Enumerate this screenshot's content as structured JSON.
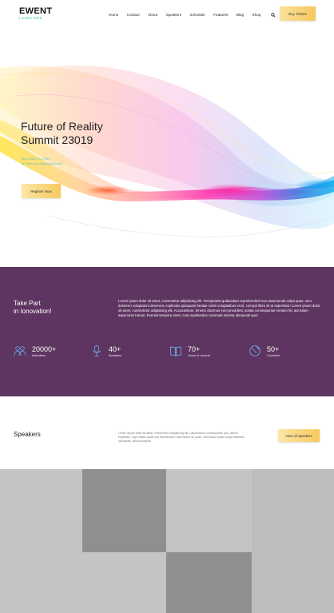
{
  "header": {
    "logo": "EWENT",
    "logo_sub": "London 2019",
    "nav": [
      "Home",
      "Contact",
      "About",
      "Speakers",
      "Schedule",
      "Features",
      "Blog",
      "Shop"
    ],
    "search_icon": "search-icon",
    "buy_label": "Buy Tickets"
  },
  "hero": {
    "title_line1": "Future of Reality",
    "title_line2": "Summit 23019",
    "date": "8th to May 10.2.2019",
    "location": "at Hilton Las Vegas Boulevard",
    "register_label": "Register Now"
  },
  "about": {
    "heading_line1": "Take Part",
    "heading_line2": "in Ionovation!",
    "body": "Lorem ipsum dolor sit amet, consectetur adipisicing elit. Perspiciatis quibusdam reprehenderit non assumenda culpa quas, vero doloreen voluptatum deserunt, explicabo quisquam beatae nobis voluptatibus error, corrupti illum sit at asperiatur! Lorem ipsum dolor sit amet, consectetur adipisicing elit. Accusantium, tenetur ducimus eum provident, soluta consequuntur veniam hic aut totam asperiores harum. Eveniet tempore amet, cum repellendus commodi minima obcaecati quo!",
    "stats": [
      {
        "value": "20000+",
        "label": "Attendees",
        "icon": "people-icon"
      },
      {
        "value": "40+",
        "label": "Speakers",
        "icon": "microphone-icon"
      },
      {
        "value": "70+",
        "label": "Hours of content",
        "icon": "book-icon"
      },
      {
        "value": "50+",
        "label": "Countries",
        "icon": "globe-icon"
      }
    ]
  },
  "speakers": {
    "title": "Speakers",
    "body": "Lorem ipsum dolor sit amet, consectetur adipisicing elit. Laboriosam consequuntur quo, labore explicabo, high officiis quam aut repellendus nulla harum de quae. Sed itaque quam culpa distinctio obcaecati, officia tempore.",
    "view_all_label": "View All Speakers"
  },
  "colors": {
    "purple": "#5e3460",
    "accent_yellow": "#f7c95e",
    "teal": "#3cc5a8"
  }
}
